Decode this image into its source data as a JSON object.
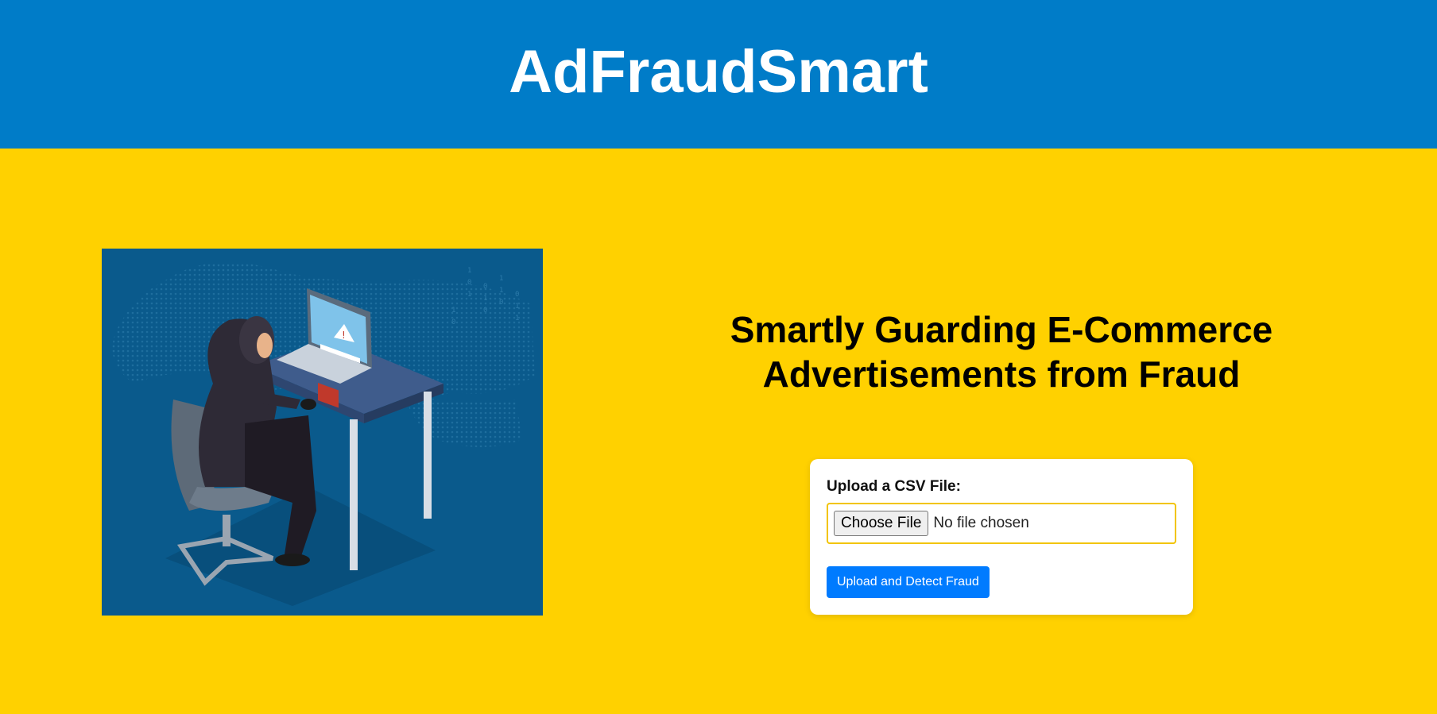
{
  "header": {
    "title": "AdFraudSmart"
  },
  "hero": {
    "icon": "hacker-at-laptop-illustration"
  },
  "main": {
    "tagline_line1": "Smartly Guarding E-Commerce",
    "tagline_line2": "Advertisements from Fraud"
  },
  "upload": {
    "label": "Upload a CSV File:",
    "choose_button": "Choose File",
    "file_status": "No file chosen",
    "submit_button": "Upload and Detect Fraud"
  },
  "colors": {
    "header_bg": "#007CC8",
    "page_bg": "#FFD100",
    "submit_bg": "#007BFF",
    "input_border": "#F2C400"
  }
}
